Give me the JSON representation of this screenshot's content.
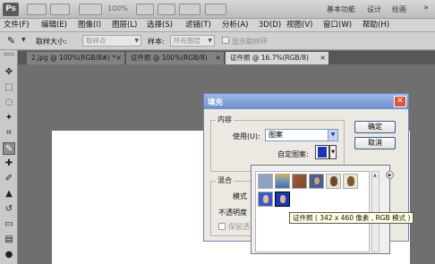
{
  "app": {
    "logo": "Ps",
    "zoom": "100%"
  },
  "workspace": {
    "basic": "基本功能",
    "design": "设计",
    "paint": "绘画"
  },
  "menu": [
    "文件(F)",
    "编辑(E)",
    "图像(I)",
    "图层(L)",
    "选择(S)",
    "滤镜(T)",
    "分析(A)",
    "3D(D)",
    "视图(V)",
    "窗口(W)",
    "帮助(H)"
  ],
  "options": {
    "sample_size_label": "取样大小:",
    "sample_size_value": "取样点",
    "sample_label": "样本:",
    "sample_value": "所有图层",
    "show_ring": "显示取样环"
  },
  "tabs": [
    {
      "label": "2.jpg @ 100%(RGB/8#) *"
    },
    {
      "label": "证件照 @ 100%(RGB/8)"
    },
    {
      "label": "证件照 @ 16.7%(RGB/8)"
    }
  ],
  "dialog": {
    "title": "填充",
    "close": "✕",
    "content_group": "内容",
    "use_label": "使用(U):",
    "use_value": "图案",
    "custom_pattern_label": "自定图案:",
    "blend_group": "混合",
    "mode_label": "模式",
    "opacity_label": "不透明度",
    "preserve_label": "保留透",
    "ok": "确定",
    "cancel": "取消"
  },
  "picker": {
    "thumbs": [
      "#8fa2c4",
      "#6a8fc0",
      "#a05c3a",
      "#4a5f8c",
      "#c9b48d",
      "#7a5a3a",
      "#3b59c2",
      "#1c36b5"
    ]
  },
  "tooltip": "证件照 ( 342 x 460 像素 , RGB 模式 )"
}
